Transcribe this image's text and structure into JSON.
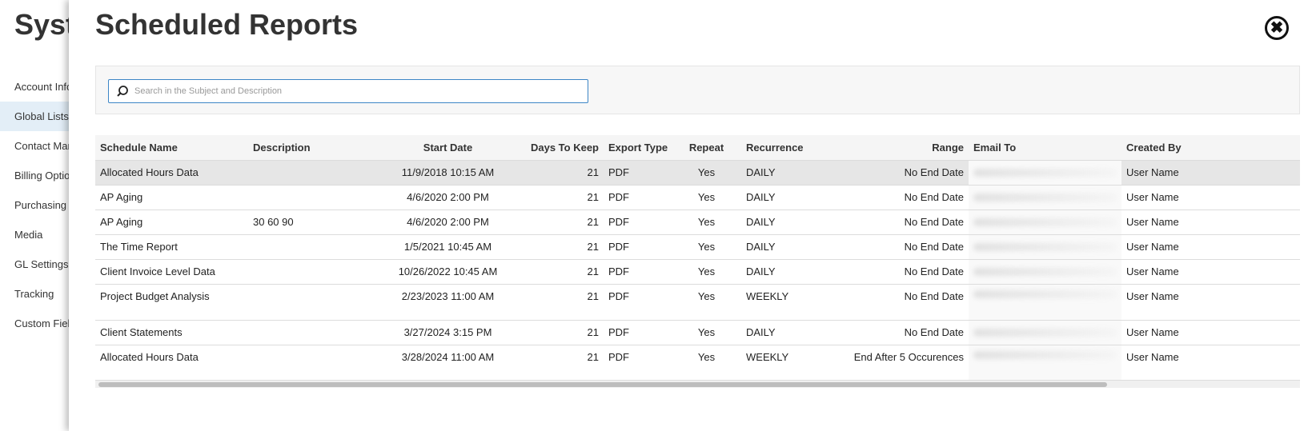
{
  "background": {
    "title": "Syste",
    "nav": [
      {
        "label": "Account Info",
        "active": false
      },
      {
        "label": "Global Lists",
        "active": true
      },
      {
        "label": "Contact Man",
        "active": false
      },
      {
        "label": "Billing Option",
        "active": false
      },
      {
        "label": "Purchasing",
        "active": false
      },
      {
        "label": "Media",
        "active": false
      },
      {
        "label": "GL Settings",
        "active": false
      },
      {
        "label": "Tracking",
        "active": false
      },
      {
        "label": "Custom Field",
        "active": false
      }
    ]
  },
  "modal": {
    "title": "Scheduled Reports",
    "close_label": "✖",
    "search": {
      "placeholder": "Search in the Subject and Description",
      "value": ""
    }
  },
  "table": {
    "columns": [
      "Schedule Name",
      "Description",
      "Start Date",
      "Days To Keep",
      "Export Type",
      "Repeat",
      "Recurrence",
      "Range",
      "Email To",
      "Created By"
    ],
    "rows": [
      {
        "name": "Allocated Hours Data",
        "description": "",
        "start": "11/9/2018 10:15 AM",
        "days": "21",
        "export": "PDF",
        "repeat": "Yes",
        "recurrence": "DAILY",
        "range": "No End Date",
        "created_by": "User Name",
        "selected": true,
        "tall": false
      },
      {
        "name": "AP Aging",
        "description": "",
        "start": "4/6/2020 2:00 PM",
        "days": "21",
        "export": "PDF",
        "repeat": "Yes",
        "recurrence": "DAILY",
        "range": "No End Date",
        "created_by": "User Name",
        "selected": false,
        "tall": false
      },
      {
        "name": "AP Aging",
        "description": "30 60 90",
        "start": "4/6/2020 2:00 PM",
        "days": "21",
        "export": "PDF",
        "repeat": "Yes",
        "recurrence": "DAILY",
        "range": "No End Date",
        "created_by": "User Name",
        "selected": false,
        "tall": false
      },
      {
        "name": "The Time Report",
        "description": "",
        "start": "1/5/2021 10:45 AM",
        "days": "21",
        "export": "PDF",
        "repeat": "Yes",
        "recurrence": "DAILY",
        "range": "No End Date",
        "created_by": "User Name",
        "selected": false,
        "tall": false
      },
      {
        "name": "Client Invoice Level Data",
        "description": "",
        "start": "10/26/2022 10:45 AM",
        "days": "21",
        "export": "PDF",
        "repeat": "Yes",
        "recurrence": "DAILY",
        "range": "No End Date",
        "created_by": "User Name",
        "selected": false,
        "tall": false
      },
      {
        "name": "Project Budget Analysis",
        "description": "",
        "start": "2/23/2023 11:00 AM",
        "days": "21",
        "export": "PDF",
        "repeat": "Yes",
        "recurrence": "WEEKLY",
        "range": "No End Date",
        "created_by": "User Name",
        "selected": false,
        "tall": true
      },
      {
        "name": "Client Statements",
        "description": "",
        "start": "3/27/2024 3:15 PM",
        "days": "21",
        "export": "PDF",
        "repeat": "Yes",
        "recurrence": "DAILY",
        "range": "No End Date",
        "created_by": "User Name",
        "selected": false,
        "tall": false
      },
      {
        "name": "Allocated Hours Data",
        "description": "",
        "start": "3/28/2024 11:00 AM",
        "days": "21",
        "export": "PDF",
        "repeat": "Yes",
        "recurrence": "WEEKLY",
        "range": "End After  5  Occurences",
        "created_by": "User Name",
        "selected": false,
        "tall": true
      }
    ]
  },
  "icons": {
    "search": "search-icon",
    "close": "close-icon"
  }
}
